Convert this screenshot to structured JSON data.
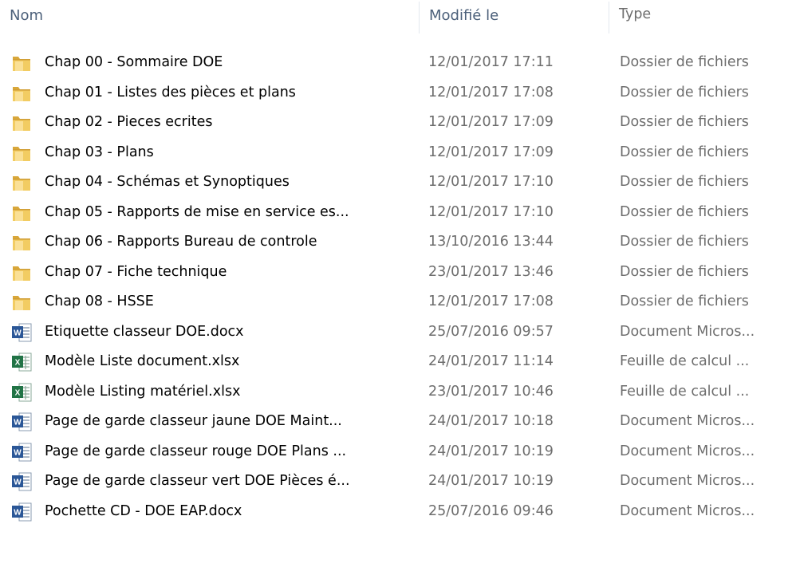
{
  "columns": {
    "name": "Nom",
    "modified": "Modifié le",
    "type": "Type"
  },
  "colors": {
    "header_text": "#4c607a",
    "secondary_text": "#6d6d6d",
    "folder": "#e6bd54",
    "word": "#2b5797",
    "excel": "#217346"
  },
  "files": [
    {
      "name": "Chap 00 - Sommaire DOE",
      "modified": "12/01/2017 17:11",
      "type": "Dossier de fichiers",
      "icon": "folder-icon"
    },
    {
      "name": "Chap 01 - Listes des pièces et plans",
      "modified": "12/01/2017 17:08",
      "type": "Dossier de fichiers",
      "icon": "folder-icon"
    },
    {
      "name": "Chap 02 - Pieces ecrites",
      "modified": "12/01/2017 17:09",
      "type": "Dossier de fichiers",
      "icon": "folder-icon"
    },
    {
      "name": "Chap 03 - Plans",
      "modified": "12/01/2017 17:09",
      "type": "Dossier de fichiers",
      "icon": "folder-icon"
    },
    {
      "name": "Chap 04 - Schémas et Synoptiques",
      "modified": "12/01/2017 17:10",
      "type": "Dossier de fichiers",
      "icon": "folder-icon"
    },
    {
      "name": "Chap 05 - Rapports de mise en service es...",
      "modified": "12/01/2017 17:10",
      "type": "Dossier de fichiers",
      "icon": "folder-icon"
    },
    {
      "name": "Chap 06 - Rapports Bureau de controle",
      "modified": "13/10/2016 13:44",
      "type": "Dossier de fichiers",
      "icon": "folder-icon"
    },
    {
      "name": "Chap 07 - Fiche technique",
      "modified": "23/01/2017 13:46",
      "type": "Dossier de fichiers",
      "icon": "folder-icon"
    },
    {
      "name": "Chap 08 - HSSE",
      "modified": "12/01/2017 17:08",
      "type": "Dossier de fichiers",
      "icon": "folder-icon"
    },
    {
      "name": "Etiquette classeur DOE.docx",
      "modified": "25/07/2016 09:57",
      "type": "Document Micros...",
      "icon": "word-document-icon"
    },
    {
      "name": "Modèle Liste document.xlsx",
      "modified": "24/01/2017 11:14",
      "type": "Feuille de calcul ...",
      "icon": "excel-document-icon"
    },
    {
      "name": "Modèle Listing matériel.xlsx",
      "modified": "23/01/2017 10:46",
      "type": "Feuille de calcul ...",
      "icon": "excel-document-icon"
    },
    {
      "name": "Page de garde classeur jaune DOE Maint...",
      "modified": "24/01/2017 10:18",
      "type": "Document Micros...",
      "icon": "word-document-icon"
    },
    {
      "name": "Page de garde classeur rouge DOE Plans ...",
      "modified": "24/01/2017 10:19",
      "type": "Document Micros...",
      "icon": "word-document-icon"
    },
    {
      "name": "Page de garde classeur vert DOE Pièces é...",
      "modified": "24/01/2017 10:19",
      "type": "Document Micros...",
      "icon": "word-document-icon"
    },
    {
      "name": "Pochette CD - DOE EAP.docx",
      "modified": "25/07/2016 09:46",
      "type": "Document Micros...",
      "icon": "word-document-icon"
    }
  ]
}
